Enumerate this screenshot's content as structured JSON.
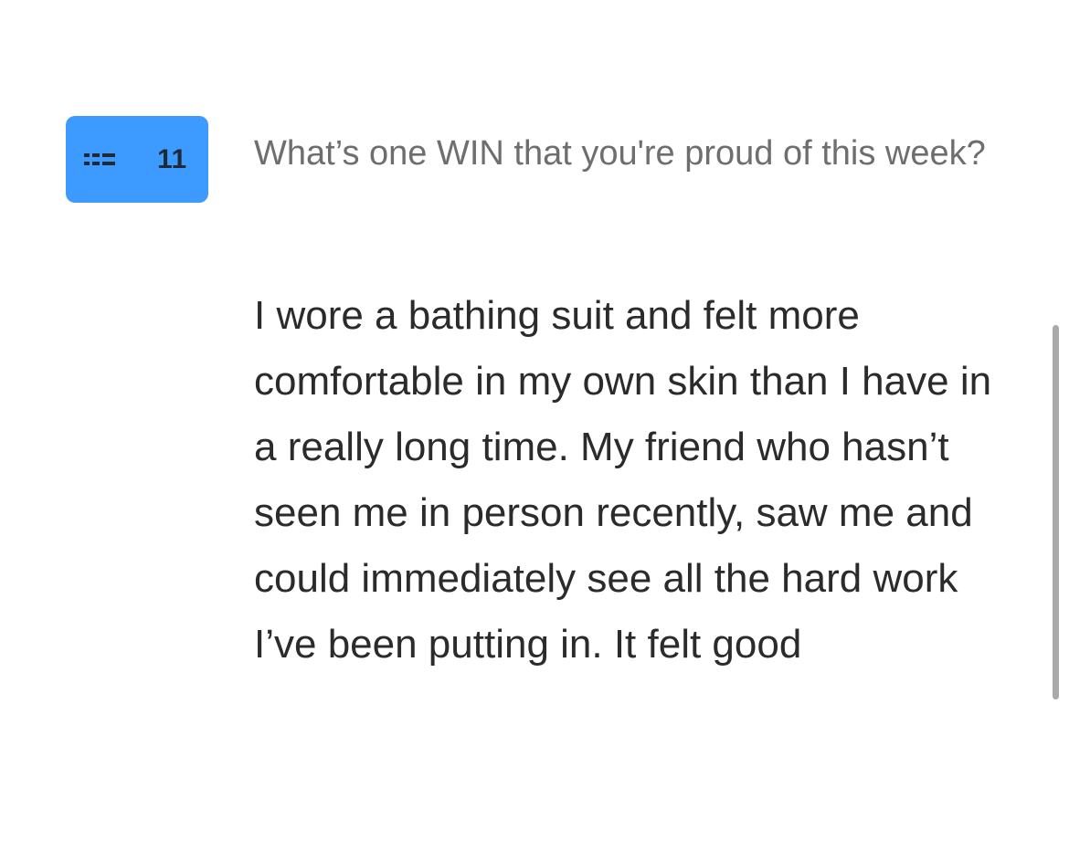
{
  "question_block": {
    "number": "11",
    "icon": "drag-handle-icon",
    "accent_color": "#3d9bff",
    "question": "What’s one WIN that you're proud of this week?",
    "answer": "I wore a bathing suit and felt more comfortable in my own skin than I have in a really long time. My friend who hasn’t seen me in person recently, saw me and could immediately see all the hard work I’ve been putting in. It felt good"
  }
}
